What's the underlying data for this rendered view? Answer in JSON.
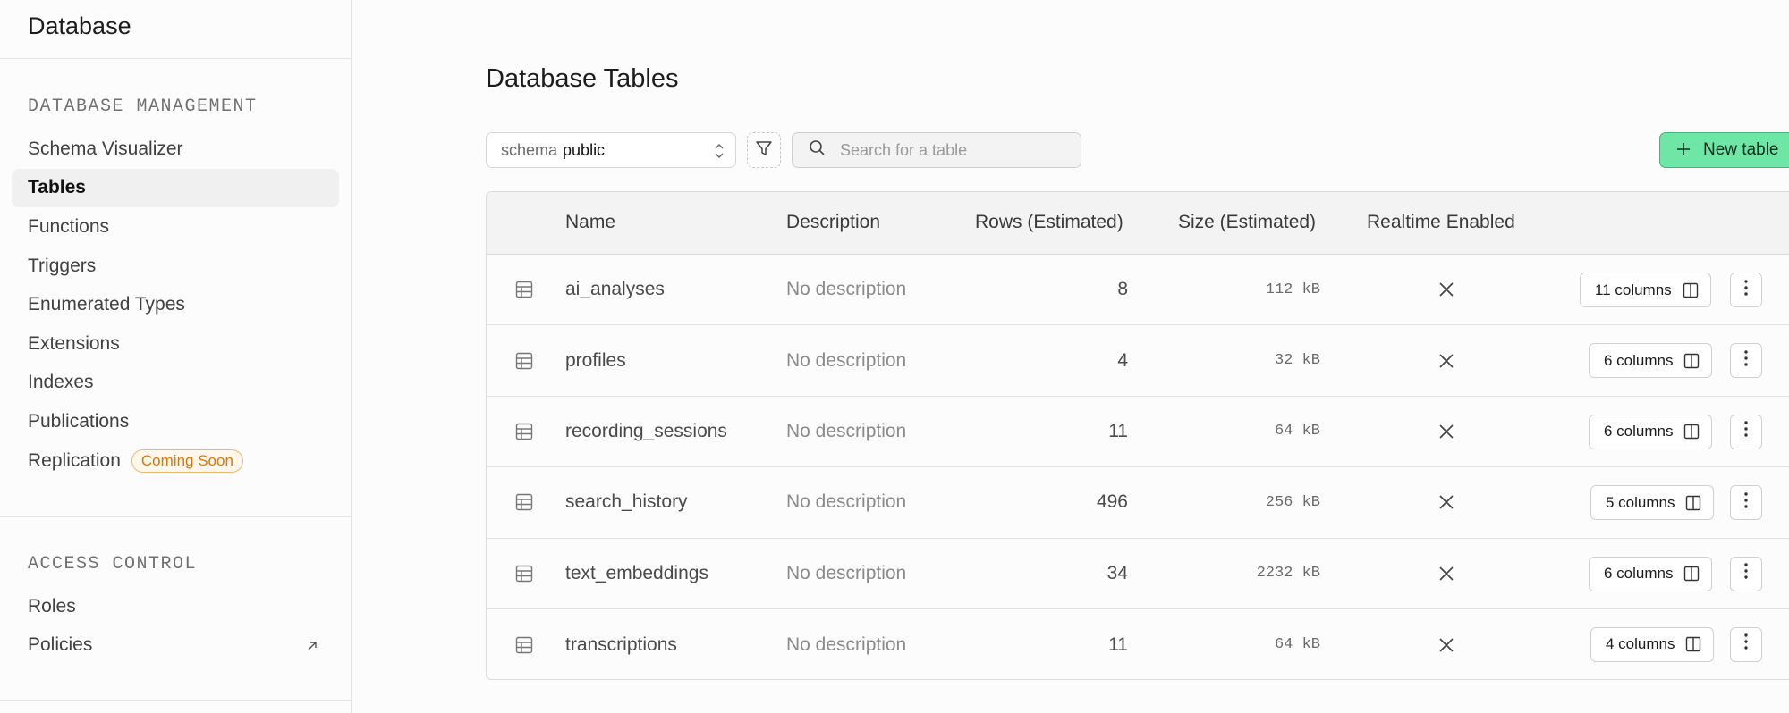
{
  "sidebar": {
    "title": "Database",
    "sections": [
      {
        "title": "DATABASE MANAGEMENT",
        "items": [
          {
            "label": "Schema Visualizer"
          },
          {
            "label": "Tables",
            "active": true
          },
          {
            "label": "Functions"
          },
          {
            "label": "Triggers"
          },
          {
            "label": "Enumerated Types"
          },
          {
            "label": "Extensions"
          },
          {
            "label": "Indexes"
          },
          {
            "label": "Publications"
          },
          {
            "label": "Replication",
            "badge": "Coming Soon"
          }
        ]
      },
      {
        "title": "ACCESS CONTROL",
        "items": [
          {
            "label": "Roles"
          },
          {
            "label": "Policies",
            "icon": "external-link-icon"
          }
        ]
      }
    ]
  },
  "main": {
    "title": "Database Tables",
    "toolbar": {
      "schema_label": "schema",
      "schema_value": "public",
      "search_placeholder": "Search for a table",
      "new_table_label": "New table"
    },
    "table": {
      "headers": {
        "name": "Name",
        "description": "Description",
        "rows": "Rows (Estimated)",
        "size": "Size (Estimated)",
        "realtime": "Realtime Enabled"
      },
      "rows": [
        {
          "name": "ai_analyses",
          "description": "No description",
          "rows": "8",
          "size": "112 kB",
          "columns": "11 columns"
        },
        {
          "name": "profiles",
          "description": "No description",
          "rows": "4",
          "size": "32 kB",
          "columns": "6 columns"
        },
        {
          "name": "recording_sessions",
          "description": "No description",
          "rows": "11",
          "size": "64 kB",
          "columns": "6 columns"
        },
        {
          "name": "search_history",
          "description": "No description",
          "rows": "496",
          "size": "256 kB",
          "columns": "5 columns"
        },
        {
          "name": "text_embeddings",
          "description": "No description",
          "rows": "34",
          "size": "2232 kB",
          "columns": "6 columns"
        },
        {
          "name": "transcriptions",
          "description": "No description",
          "rows": "11",
          "size": "64 kB",
          "columns": "4 columns"
        }
      ]
    }
  },
  "colors": {
    "accent_green": "#6ee7a6",
    "badge_orange": "#d97706"
  }
}
